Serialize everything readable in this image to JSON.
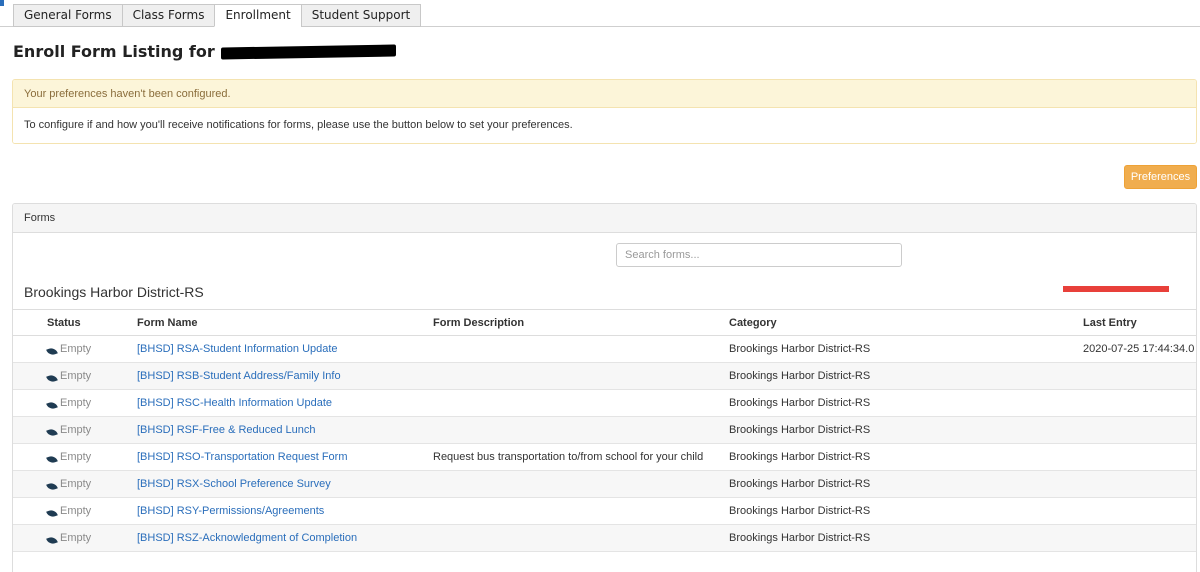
{
  "tabs": [
    {
      "label": "General Forms",
      "active": false
    },
    {
      "label": "Class Forms",
      "active": false
    },
    {
      "label": "Enrollment",
      "active": true
    },
    {
      "label": "Student Support",
      "active": false
    }
  ],
  "page": {
    "title": "Enroll Form Listing for"
  },
  "alert": {
    "heading": "Your preferences haven't been configured.",
    "body": "To configure if and how you'll receive notifications for forms, please use the button below to set your preferences."
  },
  "preferences_button": "Preferences",
  "panel": {
    "title": "Forms",
    "search_placeholder": "Search forms...",
    "group_title": "Brookings Harbor District-RS"
  },
  "table": {
    "columns": [
      "Status",
      "Form Name",
      "Form Description",
      "Category",
      "Last Entry"
    ],
    "rows": [
      {
        "status": "Empty",
        "name": "[BHSD] RSA-Student Information Update",
        "description": "",
        "category": "Brookings Harbor District-RS",
        "last_entry": "2020-07-25 17:44:34.0"
      },
      {
        "status": "Empty",
        "name": "[BHSD] RSB-Student Address/Family Info",
        "description": "",
        "category": "Brookings Harbor District-RS",
        "last_entry": ""
      },
      {
        "status": "Empty",
        "name": "[BHSD] RSC-Health Information Update",
        "description": "",
        "category": "Brookings Harbor District-RS",
        "last_entry": ""
      },
      {
        "status": "Empty",
        "name": "[BHSD] RSF-Free & Reduced Lunch",
        "description": "",
        "category": "Brookings Harbor District-RS",
        "last_entry": ""
      },
      {
        "status": "Empty",
        "name": "[BHSD] RSO-Transportation Request Form",
        "description": "Request bus transportation to/from school for your child",
        "category": "Brookings Harbor District-RS",
        "last_entry": ""
      },
      {
        "status": "Empty",
        "name": "[BHSD] RSX-School Preference Survey",
        "description": "",
        "category": "Brookings Harbor District-RS",
        "last_entry": ""
      },
      {
        "status": "Empty",
        "name": "[BHSD] RSY-Permissions/Agreements",
        "description": "",
        "category": "Brookings Harbor District-RS",
        "last_entry": ""
      },
      {
        "status": "Empty",
        "name": "[BHSD] RSZ-Acknowledgment of Completion",
        "description": "",
        "category": "Brookings Harbor District-RS",
        "last_entry": ""
      }
    ]
  },
  "icons": {
    "status": "leaf-icon"
  },
  "colors": {
    "link": "#2a6ebb",
    "preferences_button": "#f0ad4e",
    "alert_bg": "#fcf5d9",
    "alert_text": "#8a6d3b",
    "redaction_mark": "#e8403a"
  }
}
